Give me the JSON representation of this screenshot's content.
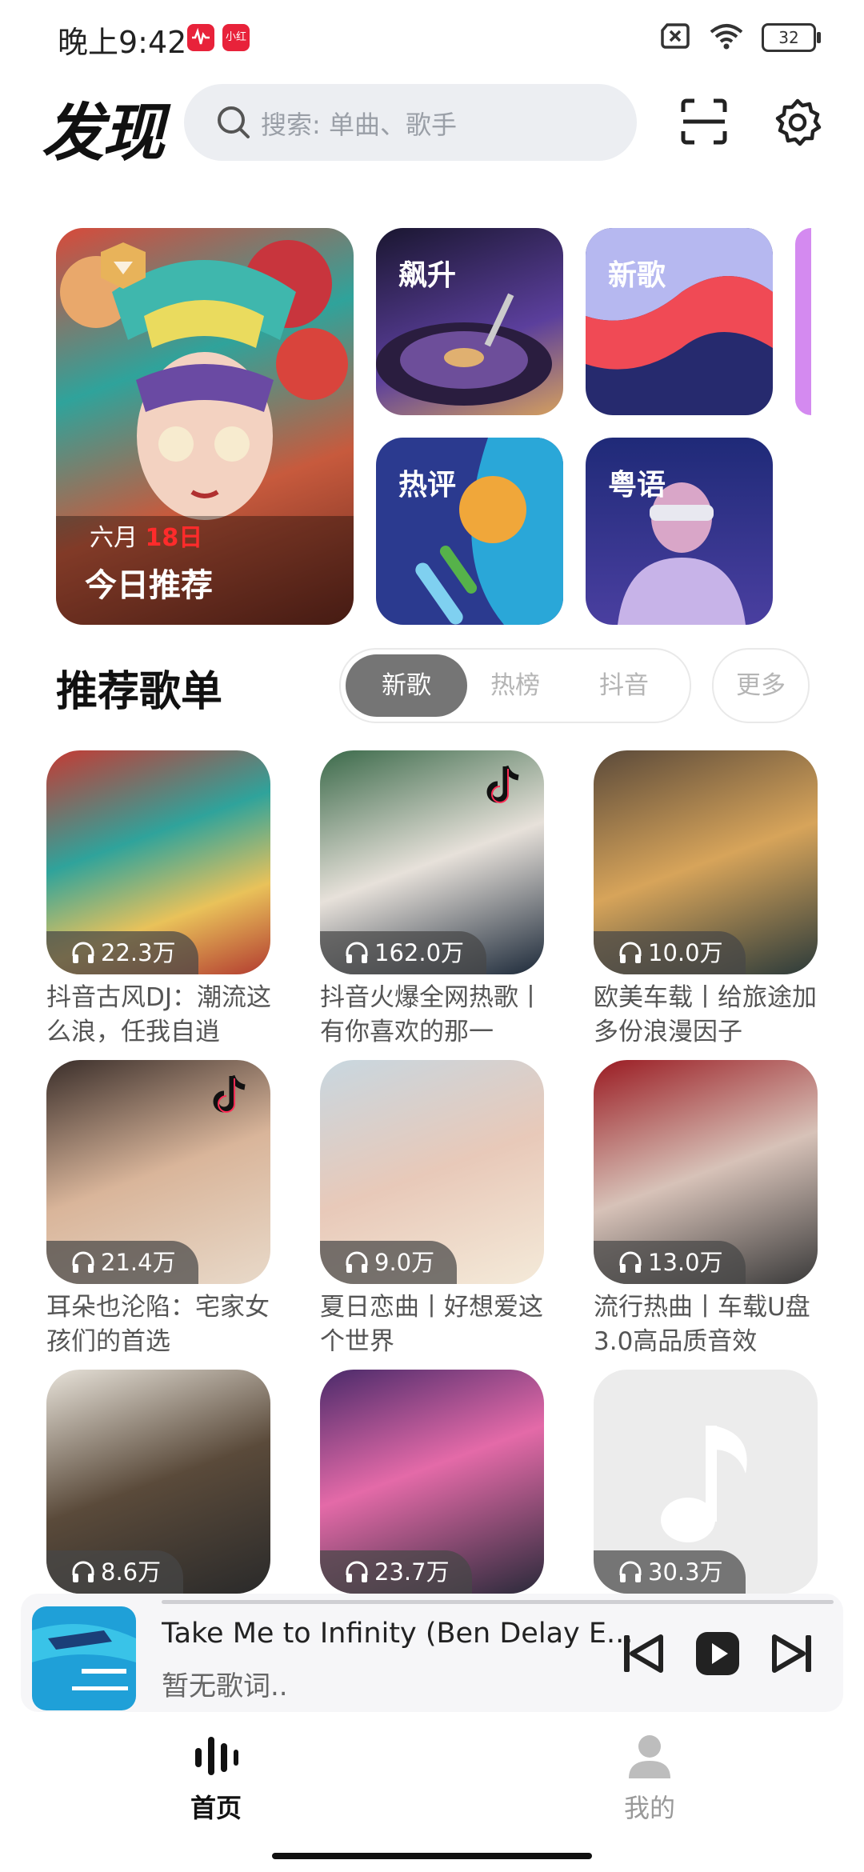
{
  "status_bar": {
    "time": "晚上9:42",
    "app_badges": [
      "",
      "小红书"
    ],
    "battery": "32"
  },
  "header": {
    "title": "发现",
    "search_placeholder": "搜索: 单曲、歌手"
  },
  "tiles": {
    "today": {
      "month": "六月",
      "day": "18日",
      "title": "今日推荐"
    },
    "rising": "飙升",
    "new_songs": "新歌",
    "hot_comments": "热评",
    "cantonese": "粤语"
  },
  "section": {
    "title": "推荐歌单",
    "tabs": [
      "新歌",
      "热榜",
      "抖音"
    ],
    "active_tab": "新歌",
    "more": "更多"
  },
  "playlists": [
    {
      "count": "22.3万",
      "title": "抖音古风DJ：潮流这么浪，任我自逍"
    },
    {
      "count": "162.0万",
      "title": "抖音火爆全网热歌丨有你喜欢的那一"
    },
    {
      "count": "10.0万",
      "title": "欧美车载丨给旅途加多份浪漫因子"
    },
    {
      "count": "21.4万",
      "title": "耳朵也沦陷：宅家女孩们的首选"
    },
    {
      "count": "9.0万",
      "title": "夏日恋曲丨好想爱这个世界"
    },
    {
      "count": "13.0万",
      "title": "流行热曲丨车载U盘3.0高品质音效"
    },
    {
      "count": "8.6万",
      "title": ""
    },
    {
      "count": "23.7万",
      "title": ""
    },
    {
      "count": "30.3万",
      "title": ""
    }
  ],
  "player": {
    "title": "Take Me to Infinity (Ben Delay E...",
    "lyrics": "暂无歌词.."
  },
  "nav": {
    "home": "首页",
    "mine": "我的"
  }
}
